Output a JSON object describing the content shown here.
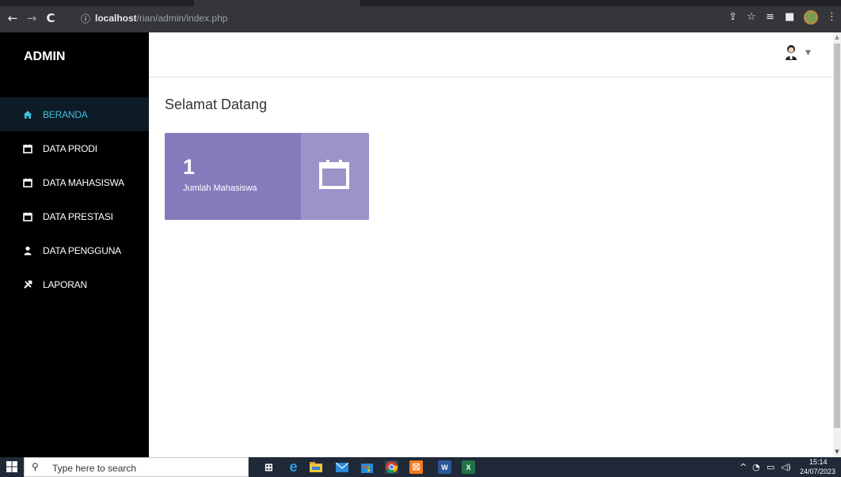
{
  "browser": {
    "url_host": "localhost",
    "url_path": "/rian/admin/index.php",
    "info_icon": "info-icon"
  },
  "sidebar": {
    "brand": "ADMIN",
    "items": [
      {
        "label": "BERANDA",
        "icon": "home-icon",
        "active": true
      },
      {
        "label": "DATA PRODI",
        "icon": "calendar-icon"
      },
      {
        "label": "DATA MAHASISWA",
        "icon": "calendar-icon"
      },
      {
        "label": "DATA PRESTASI",
        "icon": "calendar-icon"
      },
      {
        "label": "DATA PENGGUNA",
        "icon": "user-icon"
      },
      {
        "label": "LAPORAN",
        "icon": "tools-icon"
      }
    ]
  },
  "main": {
    "title": "Selamat Datang",
    "card": {
      "count": "1",
      "label": "Jumlah Mahasiswa",
      "icon": "calendar-icon"
    }
  },
  "taskbar": {
    "search_placeholder": "Type here to search",
    "time": "15:14",
    "date": "24/07/2023"
  },
  "colors": {
    "active_menu_text": "#3fc1d9",
    "card_left": "#857bbc",
    "card_right": "#9c94c9"
  }
}
